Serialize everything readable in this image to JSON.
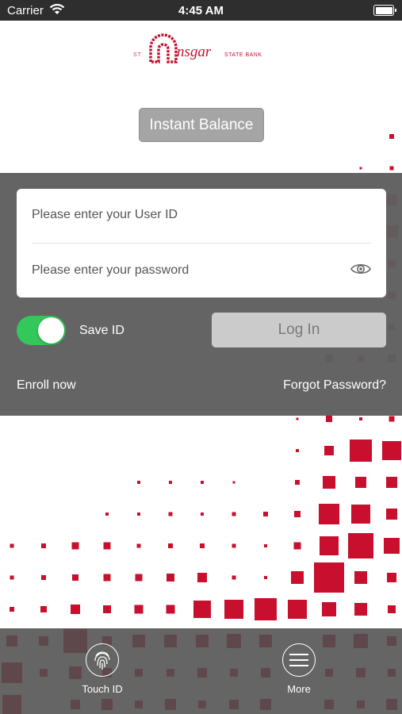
{
  "colors": {
    "brand_red": "#c8102e",
    "panel_gray": "#5f5f5f",
    "toggle_green": "#34c759"
  },
  "status_bar": {
    "carrier": "Carrier",
    "time": "4:45 AM",
    "wifi_icon": "wifi-icon",
    "battery_icon": "battery-icon"
  },
  "logo": {
    "prefix": "ST.",
    "name": "nsgar",
    "suffix": "STATE BANK"
  },
  "instant_balance": {
    "label": "Instant Balance"
  },
  "login": {
    "user_id_placeholder": "Please enter your User ID",
    "password_placeholder": "Please enter your password",
    "password_visibility_icon": "eye-icon",
    "save_id_label": "Save ID",
    "save_id_on": true,
    "login_label": "Log In",
    "enroll_label": "Enroll now",
    "forgot_label": "Forgot Password?"
  },
  "tab_bar": {
    "touch_id": {
      "label": "Touch ID",
      "icon": "fingerprint-icon"
    },
    "more": {
      "label": "More",
      "icon": "menu-icon"
    }
  }
}
